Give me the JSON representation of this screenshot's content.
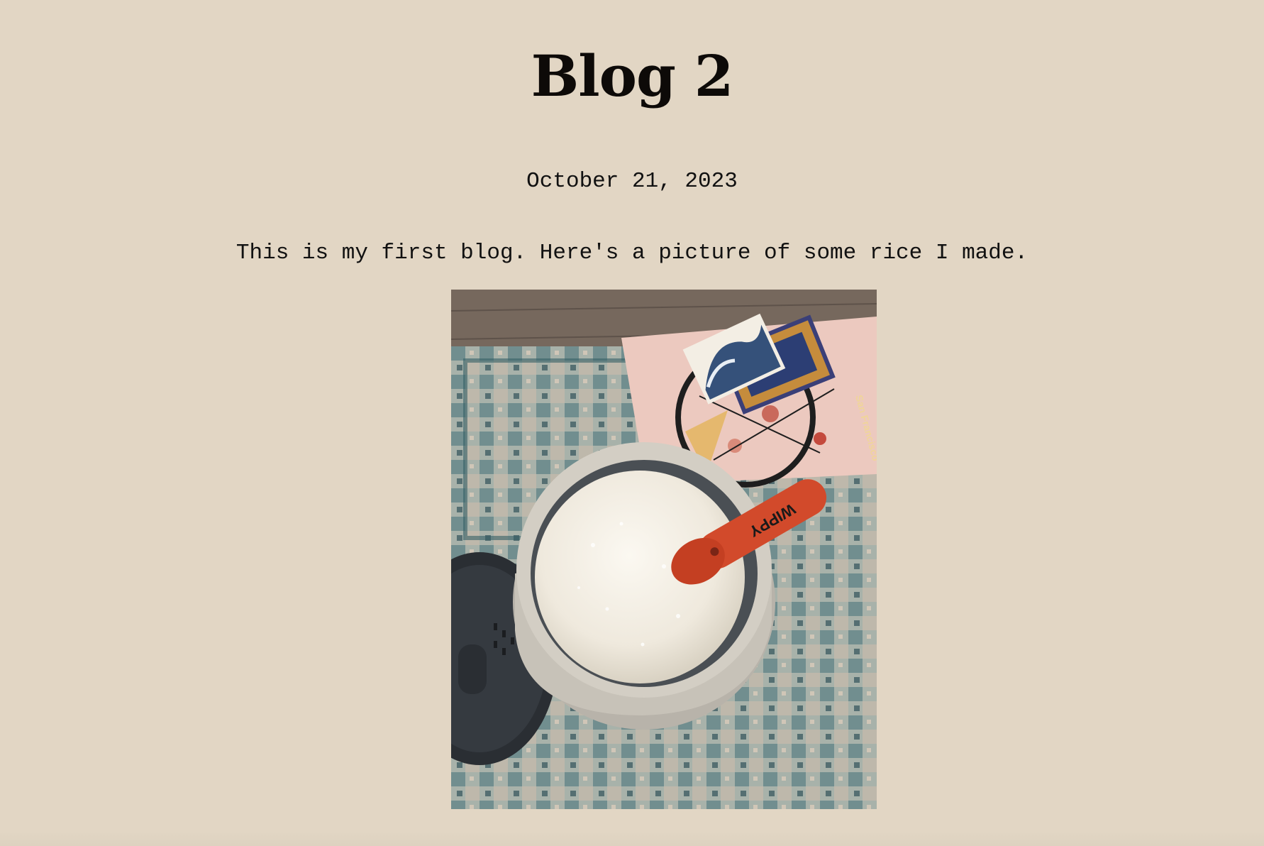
{
  "post": {
    "title": "Blog 2",
    "date": "October 21, 2023",
    "text": "This is my first blog. Here's a picture of some rice I made."
  },
  "photo": {
    "subject": "rice-cooker-photo",
    "spoon_brand": "WIPPY",
    "poster_text": "San Francisco"
  },
  "colors": {
    "background": "#e2d6c4",
    "text": "#111111"
  }
}
